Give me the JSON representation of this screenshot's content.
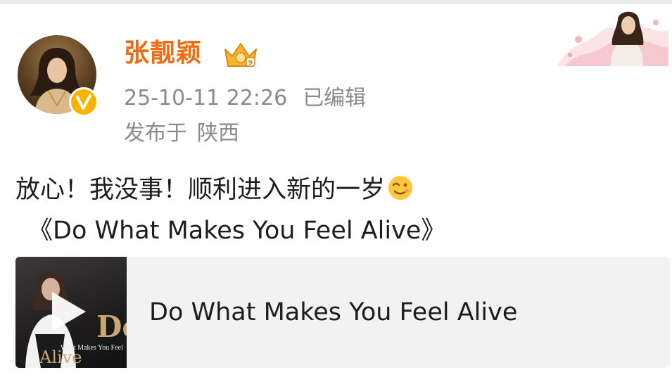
{
  "header": {
    "username": "张靓颖",
    "timestamp": "25-10-11 22:26",
    "edited": "已编辑",
    "location_prefix": "发布于",
    "location": "陕西"
  },
  "post": {
    "line1": "放心！我没事！顺利进入新的一岁",
    "line2": "《Do What Makes You Feel Alive》"
  },
  "music_card": {
    "title": "Do What Makes You Feel Alive",
    "cover_text_do": "Do",
    "cover_text_sub": "What Makes You Feel",
    "cover_text_alive": "Alive"
  },
  "icons": {
    "verified": "verified-badge-icon",
    "crown": "crown-icon",
    "emoji": "smiling-emoji-icon",
    "play": "play-icon"
  },
  "colors": {
    "username": "#f36b11",
    "meta_text": "#8a8a8a",
    "body_text": "#1d1d1d",
    "verified_badge": "#f6b400",
    "card_background": "#f2f2f2"
  }
}
